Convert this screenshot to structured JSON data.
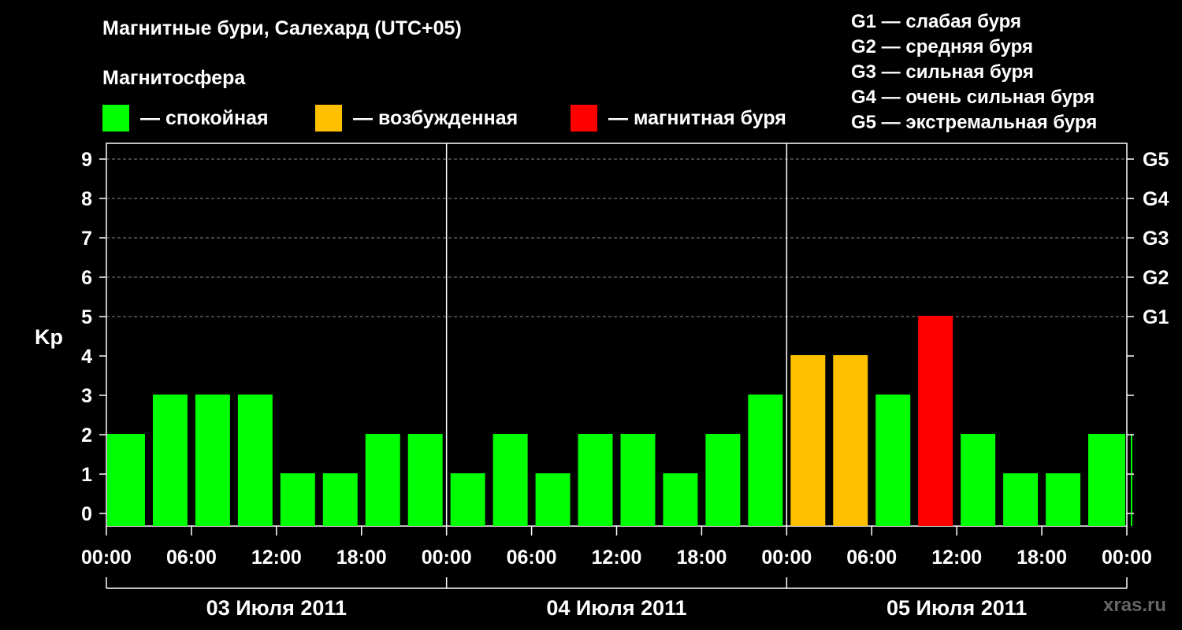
{
  "title": "Магнитные бури, Салехард (UTC+05)",
  "subtitle": "Магнитосфера",
  "legend": [
    {
      "label": "— спокойная",
      "color": "#00ff00"
    },
    {
      "label": "— возбужденная",
      "color": "#ffc000"
    },
    {
      "label": "— магнитная буря",
      "color": "#ff0000"
    }
  ],
  "g_levels": [
    "G1 — слабая буря",
    "G2 — средняя буря",
    "G3 — сильная буря",
    "G4 — очень сильная буря",
    "G5 — экстремальная буря"
  ],
  "watermark": "xras.ru",
  "chart_data": {
    "type": "bar",
    "ylabel": "Kp",
    "ylim": [
      0,
      9
    ],
    "yticks": [
      "0",
      "1",
      "2",
      "3",
      "4",
      "5",
      "6",
      "7",
      "8",
      "9"
    ],
    "right_ticks": [
      {
        "kp": 5,
        "label": "G1"
      },
      {
        "kp": 6,
        "label": "G2"
      },
      {
        "kp": 7,
        "label": "G3"
      },
      {
        "kp": 8,
        "label": "G4"
      },
      {
        "kp": 9,
        "label": "G5"
      }
    ],
    "x_tick_labels": [
      "00:00",
      "06:00",
      "12:00",
      "18:00",
      "00:00",
      "06:00",
      "12:00",
      "18:00",
      "00:00",
      "06:00",
      "12:00",
      "18:00",
      "00:00"
    ],
    "days": [
      "03 Июля 2011",
      "04 Июля 2011",
      "05 Июля 2011"
    ],
    "grid": "dashed horizontal at 5–9",
    "colors": {
      "calm": "#00ff00",
      "excited": "#ffc000",
      "storm": "#ff0000"
    },
    "values": [
      2,
      3,
      3,
      3,
      1,
      1,
      2,
      2,
      1,
      2,
      1,
      2,
      2,
      1,
      2,
      3,
      4,
      4,
      3,
      5,
      2,
      1,
      1,
      2,
      2
    ],
    "status": [
      "calm",
      "calm",
      "calm",
      "calm",
      "calm",
      "calm",
      "calm",
      "calm",
      "calm",
      "calm",
      "calm",
      "calm",
      "calm",
      "calm",
      "calm",
      "calm",
      "excited",
      "excited",
      "calm",
      "storm",
      "calm",
      "calm",
      "calm",
      "calm",
      "calm"
    ]
  }
}
